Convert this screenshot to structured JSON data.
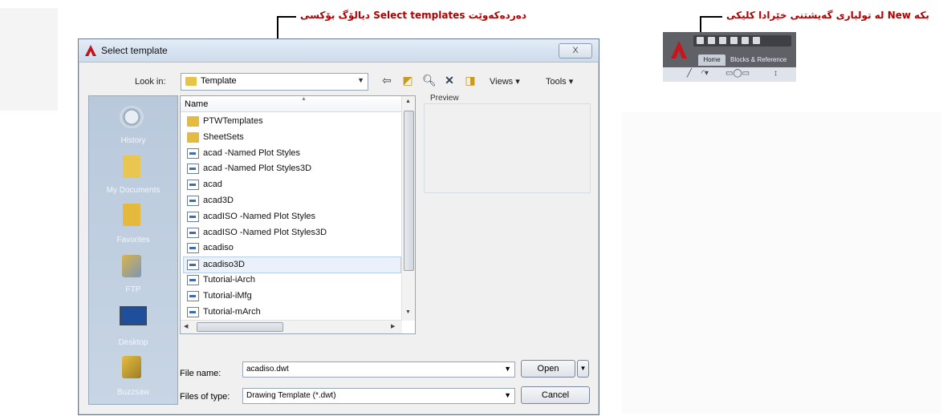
{
  "annotations": {
    "top_caption": "دیالۆگ بۆکسی Select templates دەردەکەوێت",
    "right_caption": "لە تولباری گەیشتنی خێرادا کلیکی New بکە"
  },
  "dialog": {
    "title": "Select template",
    "close_label": "X",
    "look_in_label": "Look in:",
    "look_in_value": "Template",
    "toolbar": {
      "views_label": "Views",
      "tools_label": "Tools"
    },
    "places": [
      "History",
      "My Documents",
      "Favorites",
      "FTP",
      "Desktop",
      "Buzzsaw"
    ],
    "column_name": "Name",
    "files": [
      {
        "name": "PTWTemplates",
        "type": "folder"
      },
      {
        "name": "SheetSets",
        "type": "folder"
      },
      {
        "name": "acad -Named Plot Styles",
        "type": "dwt"
      },
      {
        "name": "acad -Named Plot Styles3D",
        "type": "dwt"
      },
      {
        "name": "acad",
        "type": "dwt"
      },
      {
        "name": "acad3D",
        "type": "dwt"
      },
      {
        "name": "acadISO -Named Plot Styles",
        "type": "dwt"
      },
      {
        "name": "acadISO -Named Plot Styles3D",
        "type": "dwt"
      },
      {
        "name": "acadiso",
        "type": "dwt"
      },
      {
        "name": "acadiso3D",
        "type": "dwt",
        "selected": true
      },
      {
        "name": "Tutorial-iArch",
        "type": "dwt"
      },
      {
        "name": "Tutorial-iMfg",
        "type": "dwt"
      },
      {
        "name": "Tutorial-mArch",
        "type": "dwt"
      }
    ],
    "preview_label": "Preview",
    "file_name_label": "File name:",
    "file_name_value": "acadiso.dwt",
    "files_of_type_label": "Files of type:",
    "files_of_type_value": "Drawing Template (*.dwt)",
    "open_label": "Open",
    "cancel_label": "Cancel"
  },
  "ribbon": {
    "tab_home": "Home",
    "tab_blocks": "Blocks & Reference"
  }
}
